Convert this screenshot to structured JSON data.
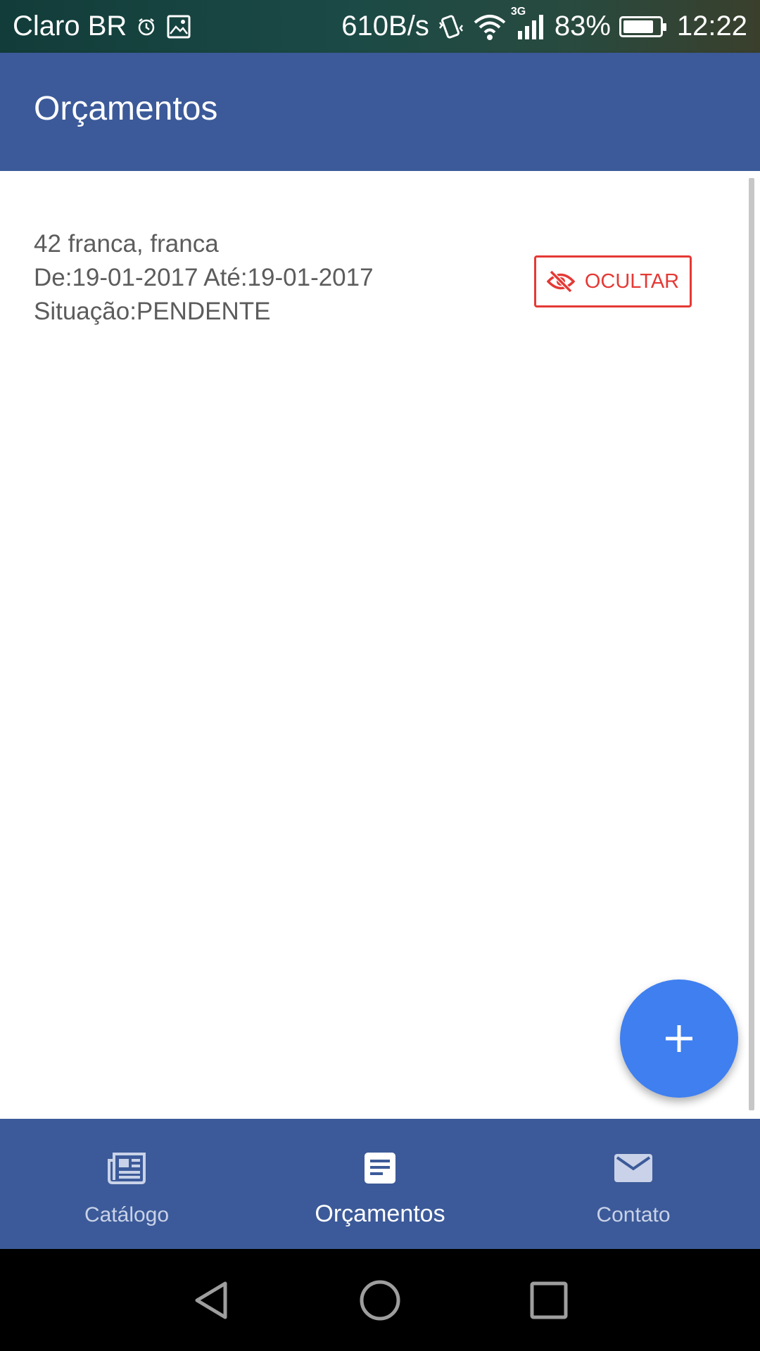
{
  "status_bar": {
    "carrier": "Claro BR",
    "net_speed": "610B/s",
    "network_type": "3G",
    "battery": "83%",
    "battery_level": 0.83,
    "time": "12:22",
    "icons": [
      "alarm-icon",
      "image-icon",
      "vibrate-icon",
      "wifi-icon",
      "signal-icon",
      "battery-icon"
    ]
  },
  "app_bar": {
    "title": "Orçamentos"
  },
  "budget_item": {
    "line1": "42 franca, franca",
    "line2": "De:19-01-2017 Até:19-01-2017",
    "line3": "Situação:PENDENTE",
    "hide_label": "OCULTAR",
    "hide_icon": "eye-off-icon"
  },
  "fab": {
    "icon": "plus-icon"
  },
  "bottom_nav": {
    "items": [
      {
        "label": "Catálogo",
        "icon": "newspaper-icon",
        "active": false
      },
      {
        "label": "Orçamentos",
        "icon": "document-icon",
        "active": true
      },
      {
        "label": "Contato",
        "icon": "mail-icon",
        "active": false
      }
    ]
  },
  "colors": {
    "primary": "#3c5a99",
    "accent_fab": "#3f7ff0",
    "danger": "#e53935",
    "nav_inactive": "#c9d2e8"
  }
}
